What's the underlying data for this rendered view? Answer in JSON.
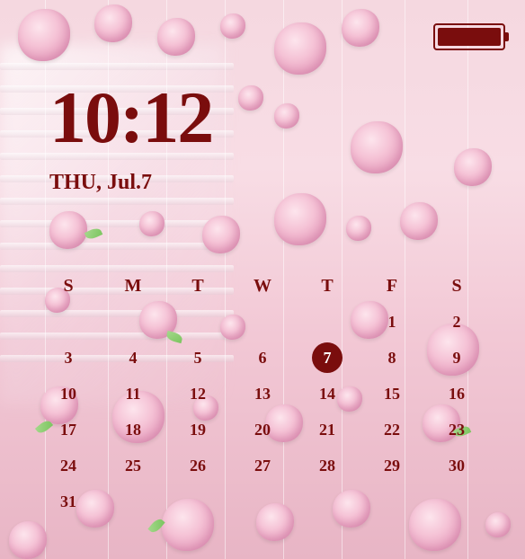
{
  "status": {
    "battery_percent": 100
  },
  "clock": {
    "time": "10:12",
    "date": "THU, Jul.7"
  },
  "calendar": {
    "headers": [
      "S",
      "M",
      "T",
      "W",
      "T",
      "F",
      "S"
    ],
    "today": 7,
    "weeks": [
      [
        "",
        "",
        "",
        "",
        "",
        "1",
        "2"
      ],
      [
        "3",
        "4",
        "5",
        "6",
        "7",
        "8",
        "9"
      ],
      [
        "10",
        "11",
        "12",
        "13",
        "14",
        "15",
        "16"
      ],
      [
        "17",
        "18",
        "19",
        "20",
        "21",
        "22",
        "23"
      ],
      [
        "24",
        "25",
        "26",
        "27",
        "28",
        "29",
        "30"
      ],
      [
        "31",
        "",
        "",
        "",
        "",
        "",
        ""
      ]
    ]
  },
  "colors": {
    "primary": "#7a0d0d"
  }
}
